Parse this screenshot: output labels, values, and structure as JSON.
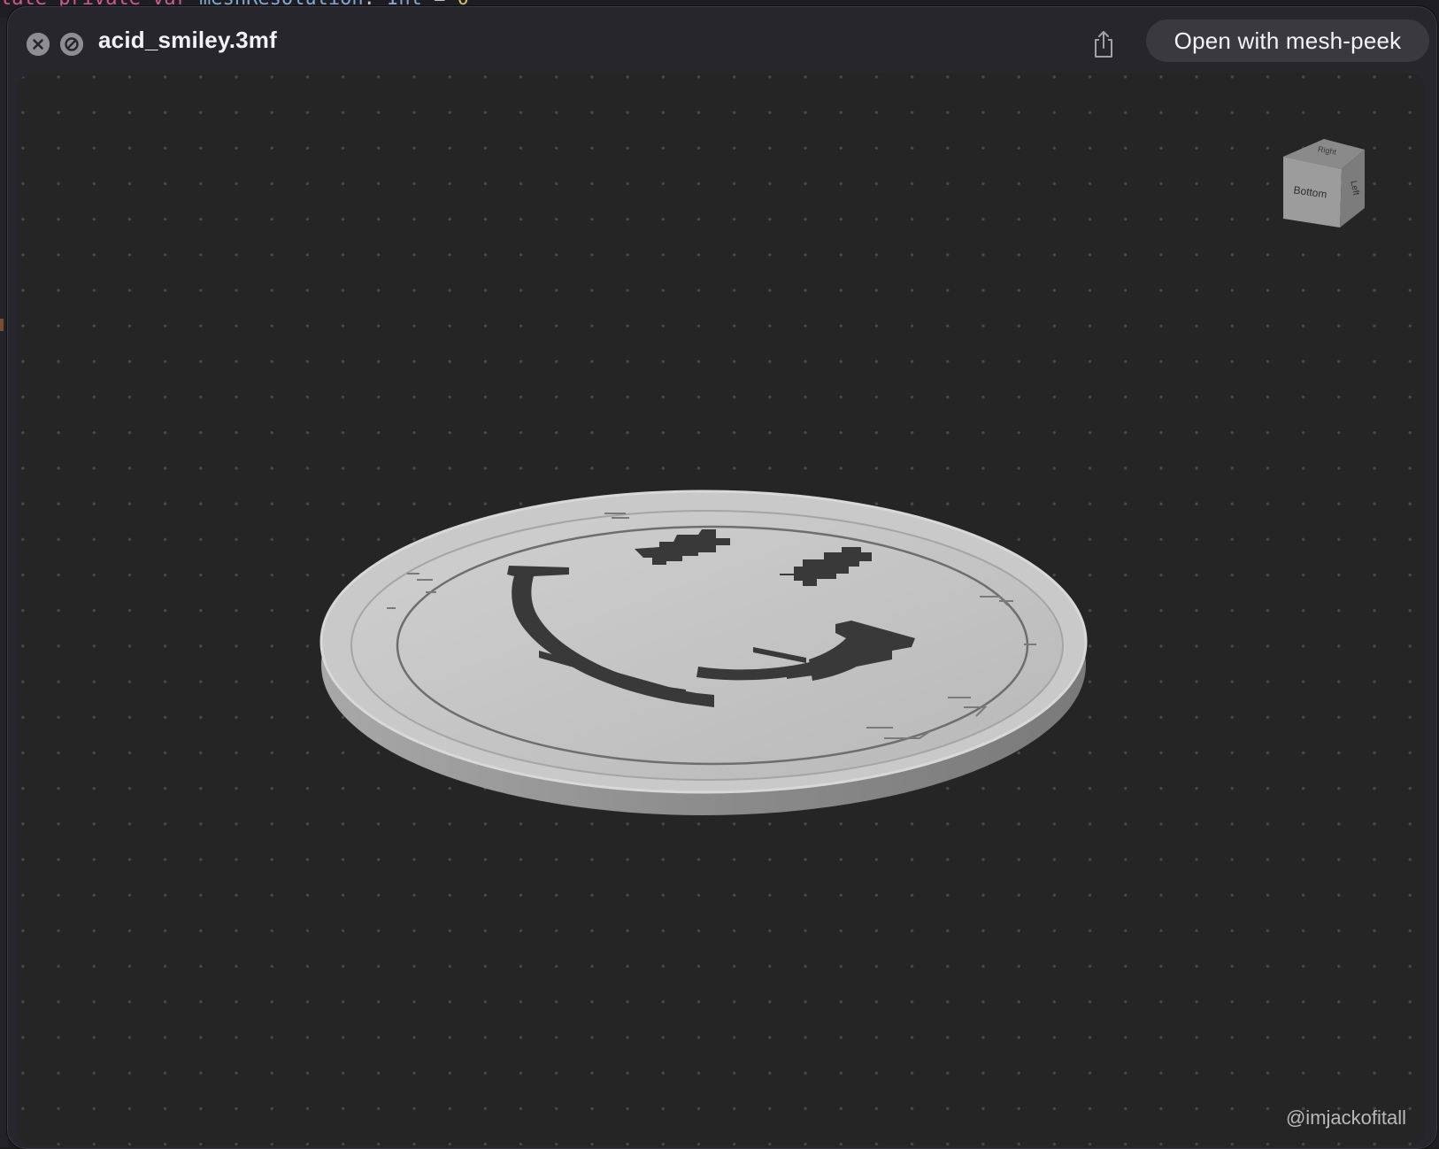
{
  "window": {
    "title": "acid_smiley.3mf",
    "open_button_label": "Open with mesh-peek"
  },
  "icons": {
    "close": "close-icon",
    "disabled": "prohibit-icon",
    "share": "share-icon"
  },
  "viewer": {
    "viewcube": {
      "faces": [
        "Right",
        "Bottom",
        "Left"
      ]
    },
    "watermark": "@imjackofitall"
  },
  "colors": {
    "window_bg": "#27262c",
    "viewport_bg": "#252526",
    "button_bg": "#3a393f",
    "model_face": "#c4c4c4",
    "model_edge": "#8f8f8f",
    "smiley_relief": "#383838"
  }
}
